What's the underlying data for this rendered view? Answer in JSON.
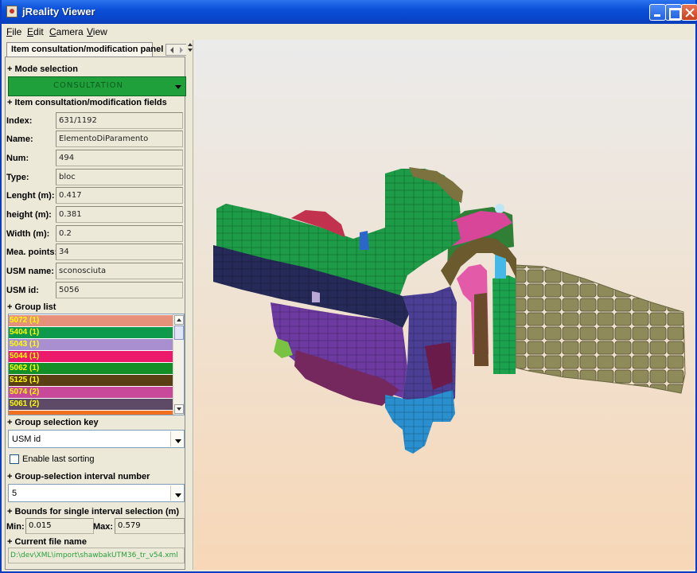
{
  "window": {
    "title": "jReality Viewer"
  },
  "menu": [
    "File",
    "Edit",
    "Camera",
    "View"
  ],
  "left_panel": {
    "tab_label": "Item consultation/modification panel",
    "mode_section": "+ Mode selection",
    "mode_value": "CONSULTATION",
    "fields_section": "+ Item consultation/modification fields",
    "fields": [
      {
        "label": "Index:",
        "value": "631/1192"
      },
      {
        "label": "Name:",
        "value": "ElementoDiParamento"
      },
      {
        "label": "Num:",
        "value": "494"
      },
      {
        "label": "Type:",
        "value": "bloc"
      },
      {
        "label": "Lenght (m):",
        "value": "0.417"
      },
      {
        "label": "height (m):",
        "value": "0.381"
      },
      {
        "label": "Width (m):",
        "value": "0.2"
      },
      {
        "label": "Mea. points:",
        "value": "34"
      },
      {
        "label": "USM name:",
        "value": "sconosciuta"
      },
      {
        "label": "USM id:",
        "value": "5056"
      }
    ],
    "group_list_section": "+ Group list",
    "group_list": [
      {
        "label": "5072 (1)",
        "color": "#e8917a",
        "text_color": "#ffff00"
      },
      {
        "label": "5404 (1)",
        "color": "#0e9a4c",
        "text_color": "#ffff00"
      },
      {
        "label": "5043 (1)",
        "color": "#a98fd0",
        "text_color": "#ffff00"
      },
      {
        "label": "5044 (1)",
        "color": "#ec1a6b",
        "text_color": "#ffff00"
      },
      {
        "label": "5062 (1)",
        "color": "#138f27",
        "text_color": "#ffff00"
      },
      {
        "label": "5125 (1)",
        "color": "#5a3f14",
        "text_color": "#ffff00"
      },
      {
        "label": "5074 (2)",
        "color": "#c8489a",
        "text_color": "#ffff00"
      },
      {
        "label": "5061 (2)",
        "color": "#5e4a66",
        "text_color": "#ffff00"
      },
      {
        "label": "",
        "color": "#f07020",
        "text_color": "#ffff00"
      }
    ],
    "group_key_section": "+ Group selection key",
    "group_key_value": "USM id",
    "enable_sorting_label": "Enable last sorting",
    "interval_section": "+ Group-selection interval number",
    "interval_value": "5",
    "bounds_section": "+ Bounds for single interval selection (m)",
    "min_label": "Min:",
    "min_value": "0.015",
    "max_label": "Max:",
    "max_value": "0.579",
    "file_section": "+ Current file name",
    "file_name": "D:\\dev\\XML\\import\\shawbakUTM36_tr_v54.xml"
  },
  "colors": {
    "mode_green": "#1fa03a",
    "file_name_green": "#2aa03d",
    "title_blue": "#0b4fd8"
  },
  "icons": [
    "app-icon",
    "minimize-icon",
    "maximize-icon",
    "close-icon",
    "scroll-left-icon",
    "scroll-right-icon",
    "dropdown-arrow-icon",
    "checkbox-icon"
  ]
}
